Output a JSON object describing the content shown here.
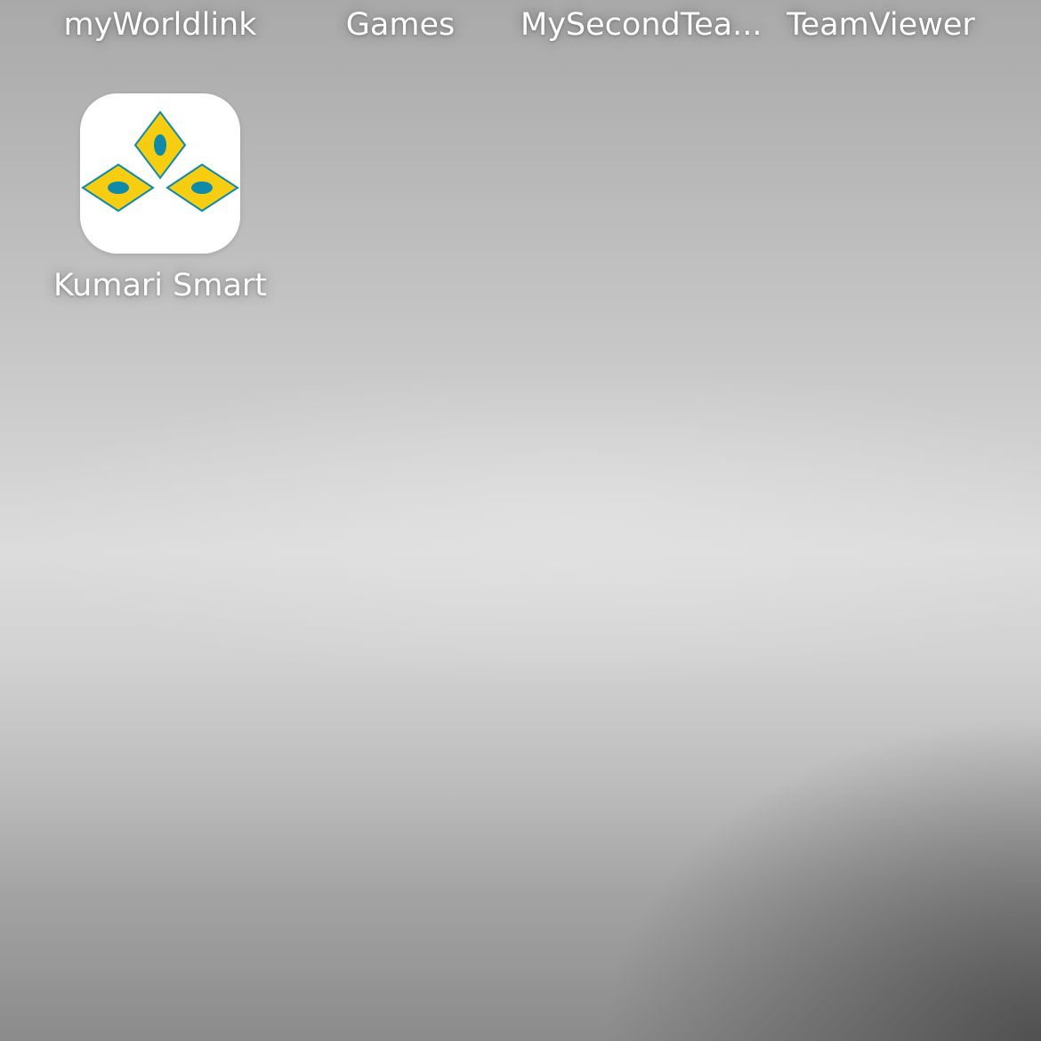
{
  "top_row_apps": [
    {
      "label": "myWorldlink"
    },
    {
      "label": "Games"
    },
    {
      "label": "MySecondTea..."
    },
    {
      "label": "TeamViewer"
    }
  ],
  "apps": [
    {
      "label": "Kumari Smart",
      "icon": "kumari-bank-logo-icon",
      "icon_colors": {
        "background": "#ffffff",
        "diamond": "#f7cd12",
        "outline": "#0f8aa8",
        "dot": "#0f8aa8"
      }
    }
  ]
}
